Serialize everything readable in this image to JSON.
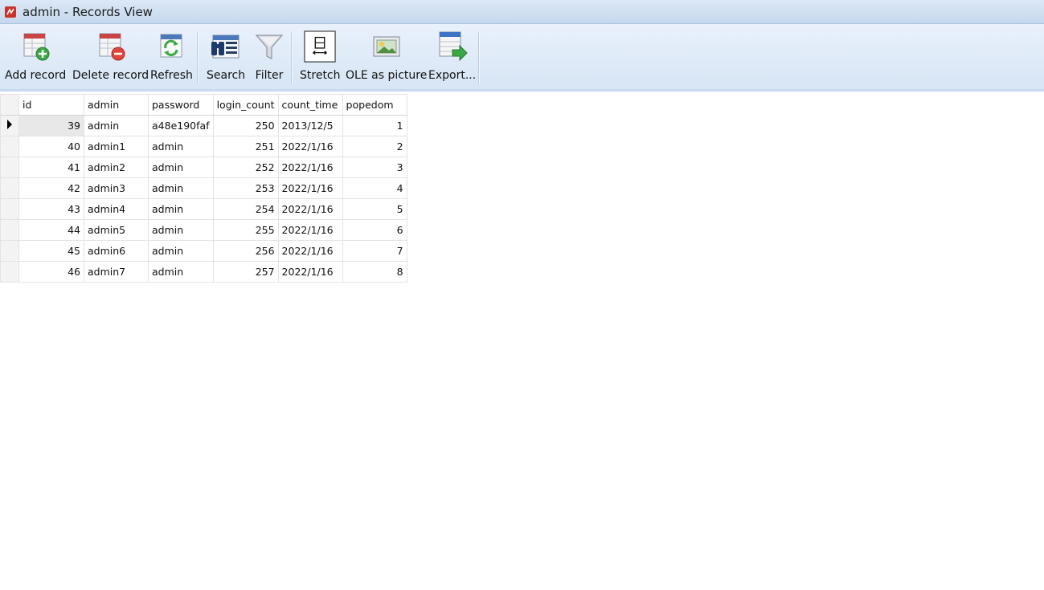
{
  "window": {
    "title": "admin - Records View"
  },
  "toolbar": {
    "buttons": [
      {
        "label": "Add record",
        "icon": "add-record-icon"
      },
      {
        "label": "Delete record",
        "icon": "delete-record-icon"
      },
      {
        "label": "Refresh",
        "icon": "refresh-icon"
      },
      {
        "label": "Search",
        "icon": "binoculars-icon"
      },
      {
        "label": "Filter",
        "icon": "funnel-icon"
      },
      {
        "label": "Stretch",
        "icon": "stretch-icon"
      },
      {
        "label": "OLE as picture",
        "icon": "picture-icon"
      },
      {
        "label": "Export...",
        "icon": "export-icon"
      }
    ]
  },
  "table": {
    "columns": [
      "id",
      "admin",
      "password",
      "login_count",
      "count_time",
      "popedom"
    ],
    "rows": [
      [
        "39",
        "admin",
        "a48e190faf",
        "250",
        "2013/12/5",
        "1"
      ],
      [
        "40",
        "admin1",
        "admin",
        "251",
        "2022/1/16",
        "2"
      ],
      [
        "41",
        "admin2",
        "admin",
        "252",
        "2022/1/16",
        "3"
      ],
      [
        "42",
        "admin3",
        "admin",
        "253",
        "2022/1/16",
        "4"
      ],
      [
        "43",
        "admin4",
        "admin",
        "254",
        "2022/1/16",
        "5"
      ],
      [
        "44",
        "admin5",
        "admin",
        "255",
        "2022/1/16",
        "6"
      ],
      [
        "45",
        "admin6",
        "admin",
        "256",
        "2022/1/16",
        "7"
      ],
      [
        "46",
        "admin7",
        "admin",
        "257",
        "2022/1/16",
        "8"
      ]
    ],
    "current_row": 0
  }
}
